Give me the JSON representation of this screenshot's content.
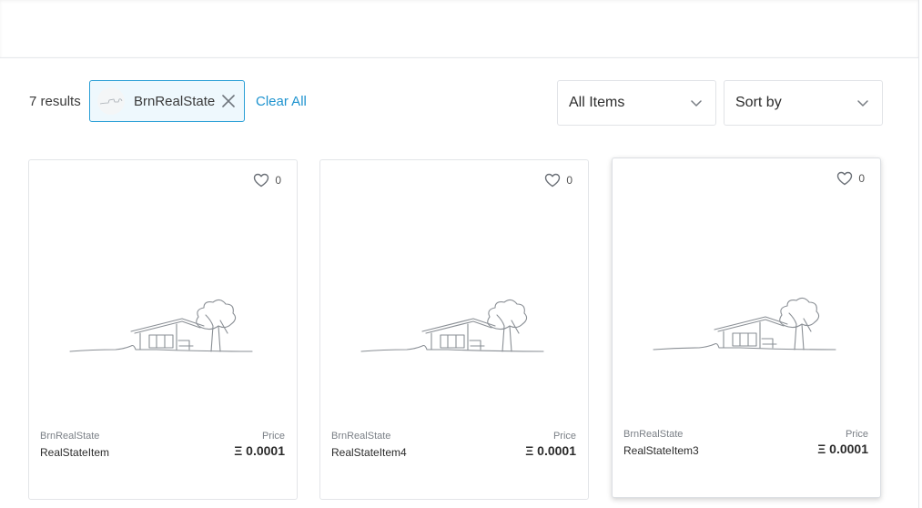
{
  "results": {
    "count_text": "7 results"
  },
  "filter_chip": {
    "label": "BrnRealState"
  },
  "clear_all": {
    "label": "Clear All"
  },
  "selects": {
    "items": {
      "value": "All Items"
    },
    "sort": {
      "value": "Sort by"
    }
  },
  "cards": [
    {
      "collection": "BrnRealState",
      "name": "RealStateItem",
      "price_label": "Price",
      "price": "Ξ 0.0001",
      "likes": "0"
    },
    {
      "collection": "BrnRealState",
      "name": "RealStateItem4",
      "price_label": "Price",
      "price": "Ξ 0.0001",
      "likes": "0"
    },
    {
      "collection": "BrnRealState",
      "name": "RealStateItem3",
      "price_label": "Price",
      "price": "Ξ 0.0001",
      "likes": "0"
    }
  ],
  "icons": {
    "chip_close": "close-icon",
    "select_chevron": "chevron-down-icon",
    "like": "heart-icon",
    "thumbnail": "house-line-drawing"
  },
  "colors": {
    "accent": "#1e93cf",
    "chip_border": "#2a9fd6",
    "chip_bg": "#eef8fd"
  }
}
